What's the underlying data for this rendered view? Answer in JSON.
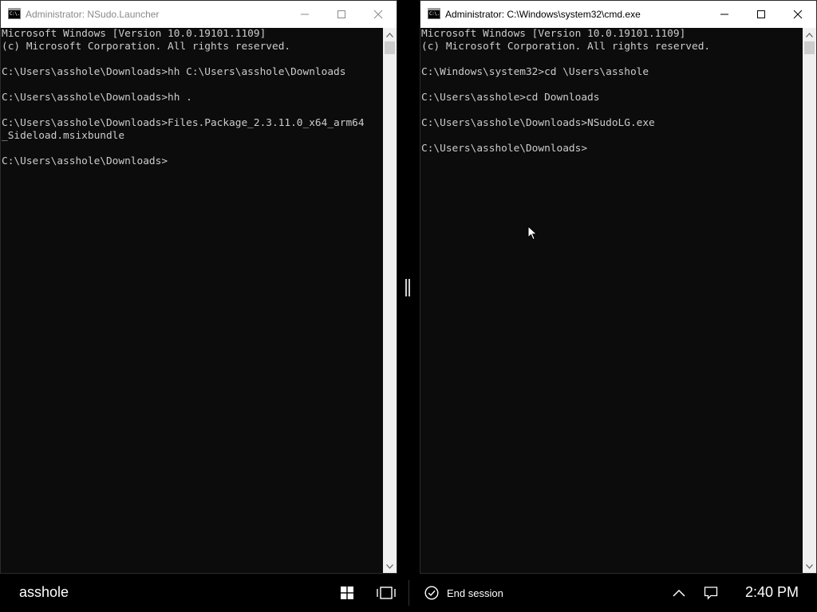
{
  "windows": [
    {
      "title": "Administrator: NSudo.Launcher",
      "icon_text": "C:\\.",
      "lines": [
        "Microsoft Windows [Version 10.0.19101.1109]",
        "(c) Microsoft Corporation. All rights reserved.",
        "",
        "C:\\Users\\asshole\\Downloads>hh C:\\Users\\asshole\\Downloads",
        "",
        "C:\\Users\\asshole\\Downloads>hh .",
        "",
        "C:\\Users\\asshole\\Downloads>Files.Package_2.3.11.0_x64_arm64",
        "_Sideload.msixbundle",
        "",
        "C:\\Users\\asshole\\Downloads>"
      ]
    },
    {
      "title": "Administrator: C:\\Windows\\system32\\cmd.exe",
      "icon_text": "C:\\.",
      "lines": [
        "Microsoft Windows [Version 10.0.19101.1109]",
        "(c) Microsoft Corporation. All rights reserved.",
        "",
        "C:\\Windows\\system32>cd \\Users\\asshole",
        "",
        "C:\\Users\\asshole>cd Downloads",
        "",
        "C:\\Users\\asshole\\Downloads>NSudoLG.exe",
        "",
        "C:\\Users\\asshole\\Downloads>"
      ]
    }
  ],
  "taskbar": {
    "user": "asshole",
    "end_session_label": "End session",
    "clock": "2:40 PM",
    "icons": [
      "windows-start-icon",
      "task-view-icon",
      "end-session-icon",
      "chevron-up-icon",
      "notification-icon"
    ]
  },
  "colors": {
    "console_bg": "#0c0c0c",
    "console_text": "#cccccc",
    "titlebar_bg": "#ffffff",
    "taskbar_bg": "#000000"
  }
}
